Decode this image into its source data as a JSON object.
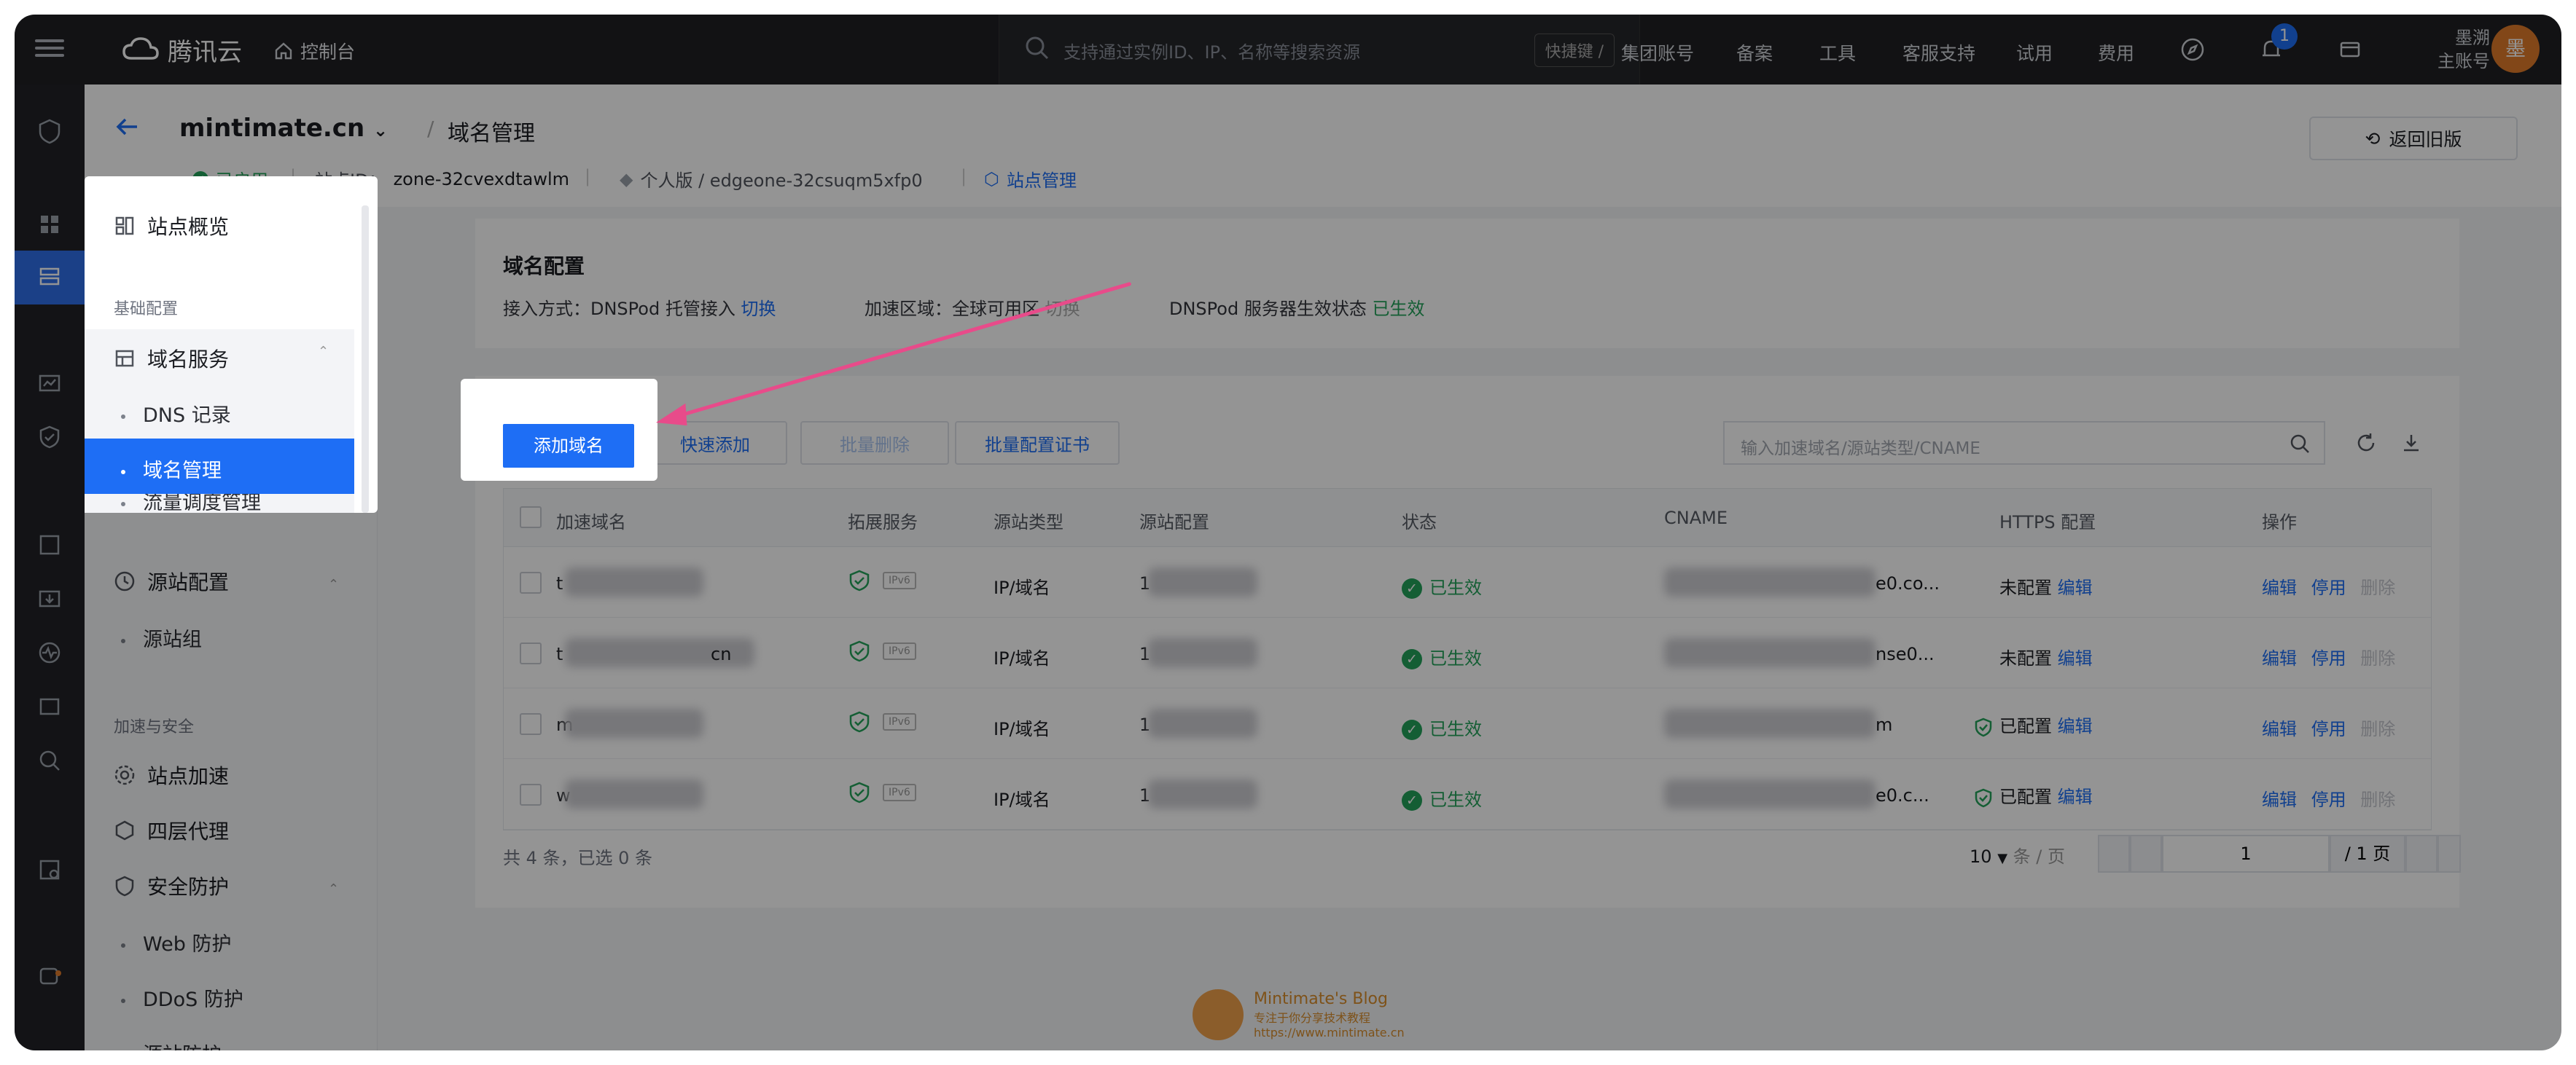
{
  "topnav": {
    "brand": "腾讯云",
    "console": "控制台",
    "search_placeholder": "支持通过实例ID、IP、名称等搜索资源",
    "shortcut": "快捷键 /",
    "items": [
      "集团账号",
      "备案",
      "工具",
      "客服支持",
      "试用",
      "费用"
    ],
    "notif_count": "1",
    "user_name": "墨溯",
    "user_role": "主账号",
    "avatar_char": "墨"
  },
  "header": {
    "domain": "mintimate.cn",
    "page": "域名管理",
    "status": "已启用",
    "site_id_label": "站点ID：",
    "site_id": "zone-32cvexdtawlm",
    "plan": "个人版 / edgeone-32csuqm5xfp0",
    "site_manage": "站点管理",
    "old_version": "返回旧版"
  },
  "sidebar": {
    "overview": "站点概览",
    "basic_section": "基础配置",
    "domain_service": "域名服务",
    "dns_records": "DNS 记录",
    "domain_manage": "域名管理",
    "traffic": "流量调度管理",
    "origin_config": "源站配置",
    "origin_group": "源站组",
    "accel_section": "加速与安全",
    "site_accel": "站点加速",
    "l4_proxy": "四层代理",
    "security": "安全防护",
    "web_protect": "Web 防护",
    "ddos": "DDoS 防护",
    "origin_protect": "源站防护"
  },
  "domain_config": {
    "title": "域名配置",
    "access_label": "接入方式：DNSPod 托管接入",
    "access_switch": "切换",
    "region_label": "加速区域：全球可用区",
    "region_switch": "切换",
    "dns_status_label": "DNSPod 服务器生效状态",
    "dns_status": "已生效"
  },
  "toolbar": {
    "add": "添加域名",
    "quick_add": "快速添加",
    "batch_delete": "批量删除",
    "batch_cert": "批量配置证书",
    "search_placeholder": "输入加速域名/源站类型/CNAME"
  },
  "table": {
    "headers": [
      "加速域名",
      "拓展服务",
      "源站类型",
      "源站配置",
      "状态",
      "CNAME",
      "HTTPS 配置",
      "操作"
    ],
    "rows": [
      {
        "domain_prefix": "t",
        "domain_suffix": "",
        "origin_type": "IP/域名",
        "origin_prefix": "1",
        "status": "已生效",
        "cname_suffix": "e0.co...",
        "https": "未配置",
        "https_edit": "编辑",
        "https_ok": false
      },
      {
        "domain_prefix": "t",
        "domain_suffix": "cn",
        "origin_type": "IP/域名",
        "origin_prefix": "1",
        "status": "已生效",
        "cname_suffix": "nse0...",
        "https": "未配置",
        "https_edit": "编辑",
        "https_ok": false
      },
      {
        "domain_prefix": "m",
        "domain_suffix": "",
        "origin_type": "IP/域名",
        "origin_prefix": "1",
        "status": "已生效",
        "cname_suffix": "m",
        "https": "已配置",
        "https_edit": "编辑",
        "https_ok": true
      },
      {
        "domain_prefix": "w",
        "domain_suffix": "",
        "origin_type": "IP/域名",
        "origin_prefix": "1",
        "status": "已生效",
        "cname_suffix": "e0.c...",
        "https": "已配置",
        "https_edit": "编辑",
        "https_ok": true
      }
    ],
    "ipv6": "IPv6",
    "actions": [
      "编辑",
      "停用",
      "删除"
    ]
  },
  "footer": {
    "summary": "共 4 条，已选 0 条",
    "page_size": "10",
    "per_page": "条 / 页",
    "page": "1",
    "total_pages": "/ 1 页"
  },
  "watermark": {
    "title": "Mintimate's Blog",
    "subtitle": "专注于你分享技术教程",
    "url": "https://www.mintimate.cn"
  }
}
